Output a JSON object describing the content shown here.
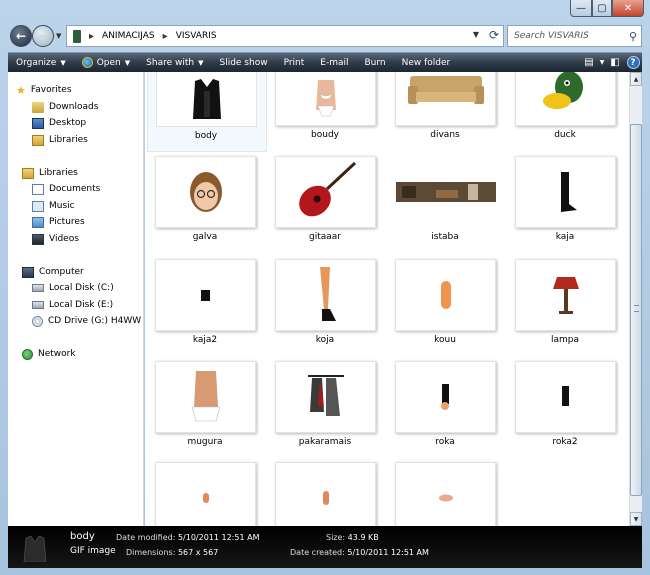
{
  "address": {
    "crumbs": [
      "ANIMACIJAS",
      "VISVARIS"
    ],
    "search_placeholder": "Search VISVARIS"
  },
  "toolbar": {
    "organize": "Organize",
    "open": "Open",
    "share_with": "Share with",
    "slide_show": "Slide show",
    "print": "Print",
    "email": "E-mail",
    "burn": "Burn",
    "new_folder": "New folder"
  },
  "nav": {
    "favorites": "Favorites",
    "downloads": "Downloads",
    "desktop": "Desktop",
    "libraries_fav": "Libraries",
    "libraries": "Libraries",
    "documents": "Documents",
    "music": "Music",
    "pictures": "Pictures",
    "videos": "Videos",
    "computer": "Computer",
    "disk_c": "Local Disk (C:)",
    "disk_e": "Local Disk (E:)",
    "cd": "CD Drive (G:) H4WW",
    "network": "Network"
  },
  "files": {
    "f0": "body",
    "f1": "boudy",
    "f2": "divans",
    "f3": "duck",
    "f4": "galva",
    "f5": "gitaaar",
    "f6": "istaba",
    "f7": "kaja",
    "f8": "kaja2",
    "f9": "koja",
    "f10": "kouu",
    "f11": "lampa",
    "f12": "mugura",
    "f13": "pakaramais",
    "f14": "roka",
    "f15": "roka2"
  },
  "details": {
    "name": "body",
    "type": "GIF image",
    "date_modified_label": "Date modified:",
    "date_modified": "5/10/2011 12:51 AM",
    "size_label": "Size:",
    "size": "43.9 KB",
    "dimensions_label": "Dimensions:",
    "dimensions": "567 x 567",
    "date_created_label": "Date created:",
    "date_created": "5/10/2011 12:51 AM"
  },
  "icons": [
    "back-icon",
    "forward-icon",
    "folder-icon",
    "refresh-icon",
    "search-icon",
    "open-icon",
    "views-icon",
    "preview-pane-icon",
    "help-icon",
    "star-icon",
    "library-icon",
    "computer-icon",
    "disk-icon",
    "cd-icon",
    "network-icon"
  ]
}
